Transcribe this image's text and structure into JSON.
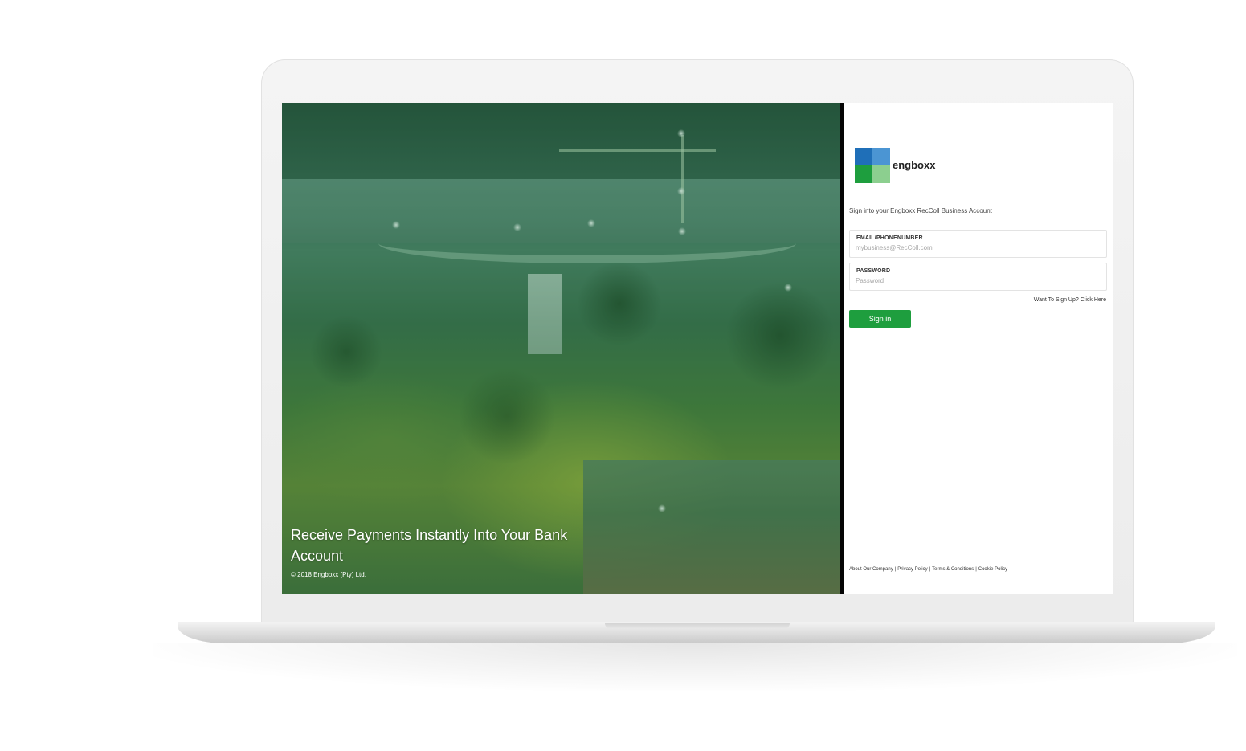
{
  "hero": {
    "headline": "Receive Payments Instantly Into Your Bank Account",
    "copyright": "© 2018 Engboxx (Pty) Ltd."
  },
  "brand": {
    "name": "engboxx",
    "logo_colors": [
      "#1f6fb8",
      "#4b95d3",
      "#1e9e3e",
      "#8ccf8f"
    ]
  },
  "login": {
    "subtitle": "Sign into your Engboxx RecColl Business Account",
    "email": {
      "label": "EMAIL/PHONENUMBER",
      "placeholder": "mybusiness@RecColl.com"
    },
    "password": {
      "label": "PASSWORD",
      "placeholder": "Password"
    },
    "signup_link": "Want To Sign Up? Click Here",
    "signin_button": "Sign in"
  },
  "footer": {
    "links": [
      "About Our Company",
      "Privacy Policy",
      "Terms & Conditions",
      "Cookie Policy"
    ],
    "separator": "|"
  },
  "colors": {
    "accent": "#1e9e3e",
    "divider": "#050505"
  }
}
